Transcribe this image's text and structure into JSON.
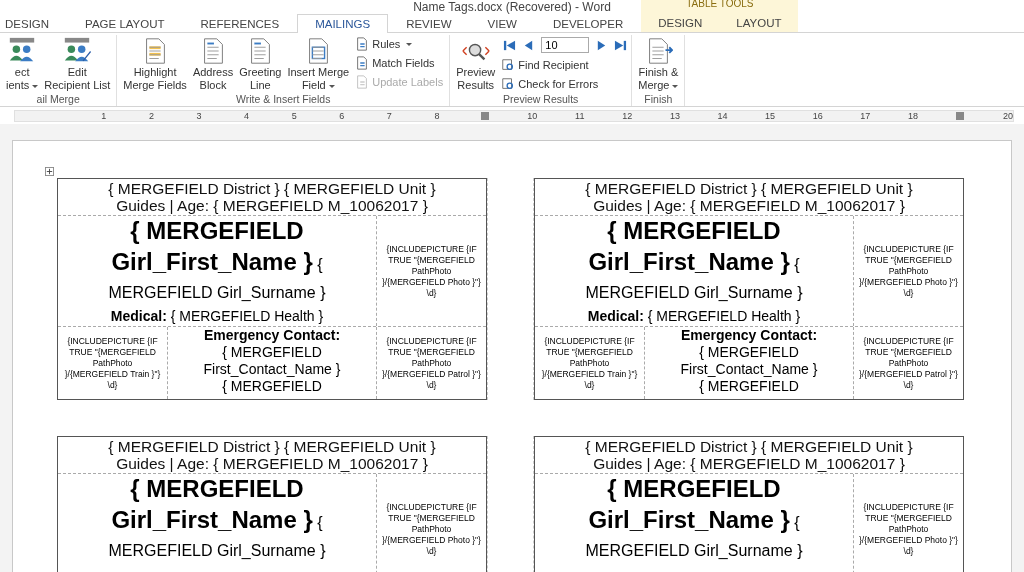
{
  "window": {
    "title": "Name Tags.docx (Recovered) - Word"
  },
  "tabs": [
    {
      "label": "DESIGN",
      "selected": false
    },
    {
      "label": "PAGE LAYOUT",
      "selected": false
    },
    {
      "label": "REFERENCES",
      "selected": false
    },
    {
      "label": "MAILINGS",
      "selected": true
    },
    {
      "label": "REVIEW",
      "selected": false
    },
    {
      "label": "VIEW",
      "selected": false
    },
    {
      "label": "DEVELOPER",
      "selected": false
    }
  ],
  "contextual": {
    "title": "TABLE TOOLS",
    "tabs": [
      {
        "label": "DESIGN",
        "selected": false
      },
      {
        "label": "LAYOUT",
        "selected": false
      }
    ]
  },
  "ribbon": [
    {
      "label": "ail Merge",
      "items": [
        {
          "kind": "large",
          "label": "ect\nients",
          "dropdown": true
        },
        {
          "kind": "large",
          "label": "Edit\nRecipient List",
          "dropdown": false
        }
      ]
    },
    {
      "label": "Write & Insert Fields",
      "items": [
        {
          "kind": "large",
          "label": "Highlight\nMerge Fields",
          "dropdown": false
        },
        {
          "kind": "large",
          "label": "Address\nBlock",
          "dropdown": false
        },
        {
          "kind": "large",
          "label": "Greeting\nLine",
          "dropdown": false
        },
        {
          "kind": "large",
          "label": "Insert Merge\nField",
          "dropdown": true
        },
        {
          "kind": "stack",
          "rows": [
            {
              "label": "Rules",
              "dropdown": true,
              "disabled": false
            },
            {
              "label": "Match Fields",
              "dropdown": false,
              "disabled": false
            },
            {
              "label": "Update Labels",
              "dropdown": false,
              "disabled": true
            }
          ]
        }
      ]
    },
    {
      "label": "Preview Results",
      "items": [
        {
          "kind": "large",
          "label": "Preview\nResults",
          "dropdown": false
        },
        {
          "kind": "nav",
          "record": "10",
          "rows": [
            {
              "label": "Find Recipient",
              "dropdown": false,
              "disabled": false
            },
            {
              "label": "Check for Errors",
              "dropdown": false,
              "disabled": false
            }
          ]
        }
      ]
    },
    {
      "label": "Finish",
      "items": [
        {
          "kind": "large",
          "label": "Finish &\nMerge",
          "dropdown": true
        }
      ]
    }
  ],
  "ruler": [
    {
      "kind": "number",
      "label": "1"
    },
    {
      "kind": "number",
      "label": "2"
    },
    {
      "kind": "number",
      "label": "3"
    },
    {
      "kind": "number",
      "label": "4"
    },
    {
      "kind": "number",
      "label": "5"
    },
    {
      "kind": "number",
      "label": "6"
    },
    {
      "kind": "number",
      "label": "7"
    },
    {
      "kind": "number",
      "label": "8"
    },
    {
      "kind": "marker"
    },
    {
      "kind": "number",
      "label": "10"
    },
    {
      "kind": "number",
      "label": "11"
    },
    {
      "kind": "number",
      "label": "12"
    },
    {
      "kind": "number",
      "label": "13"
    },
    {
      "kind": "number",
      "label": "14"
    },
    {
      "kind": "number",
      "label": "15"
    },
    {
      "kind": "number",
      "label": "16"
    },
    {
      "kind": "number",
      "label": "17"
    },
    {
      "kind": "number",
      "label": "18"
    },
    {
      "kind": "marker"
    },
    {
      "kind": "number",
      "label": "20"
    }
  ],
  "tags": [
    {
      "header": [
        "{ MERGEFIELD District } { MERGEFIELD Unit }",
        "Guides | Age: { MERGEFIELD M_10062017 }"
      ],
      "first_name": "{ MERGEFIELD Girl_First_Name }",
      "surname": "{ MERGEFIELD Girl_Surname }",
      "photo": "{INCLUDEPICTURE {IF TRUE \"{MERGEFIELD PathPhoto }/{MERGEFIELD Photo }\"} \\d}",
      "medical": "**Medical:** { MERGEFIELD Health }",
      "train": "{INCLUDEPICTURE {IF TRUE \"{MERGEFIELD PathPhoto }/{MERGEFIELD Train }\"} \\d}",
      "contact_heading": "Emergency Contact:",
      "contact": [
        "{ MERGEFIELD First_Contact_Name }",
        "{ MERGEFIELD"
      ],
      "patrol": "{INCLUDEPICTURE {IF TRUE \"{MERGEFIELD PathPhoto }/{MERGEFIELD Patrol }\"} \\d}"
    },
    {
      "header": [
        "{ MERGEFIELD District } { MERGEFIELD Unit }",
        "Guides | Age: { MERGEFIELD M_10062017 }"
      ],
      "first_name": "{ MERGEFIELD Girl_First_Name }",
      "surname": "{ MERGEFIELD Girl_Surname }",
      "photo": "{INCLUDEPICTURE {IF TRUE \"{MERGEFIELD PathPhoto }/{MERGEFIELD Photo }\"} \\d}",
      "medical": "**Medical:** { MERGEFIELD Health }",
      "train": "{INCLUDEPICTURE {IF TRUE \"{MERGEFIELD PathPhoto }/{MERGEFIELD Train }\"} \\d}",
      "contact_heading": "Emergency Contact:",
      "contact": [
        "{ MERGEFIELD First_Contact_Name }",
        "{ MERGEFIELD"
      ],
      "patrol": "{INCLUDEPICTURE {IF TRUE \"{MERGEFIELD PathPhoto }/{MERGEFIELD Patrol }\"} \\d}"
    },
    {
      "header": [
        "{ MERGEFIELD District } { MERGEFIELD Unit }",
        "Guides | Age: { MERGEFIELD M_10062017 }"
      ],
      "first_name": "{ MERGEFIELD Girl_First_Name }",
      "surname": "{ MERGEFIELD Girl_Surname }",
      "photo": "{INCLUDEPICTURE {IF TRUE \"{MERGEFIELD PathPhoto }/{MERGEFIELD Photo }\"} \\d}"
    },
    {
      "header": [
        "{ MERGEFIELD District } { MERGEFIELD Unit }",
        "Guides | Age: { MERGEFIELD M_10062017 }"
      ],
      "first_name": "{ MERGEFIELD Girl_First_Name }",
      "surname": "{ MERGEFIELD Girl_Surname }",
      "photo": "{INCLUDEPICTURE {IF TRUE \"{MERGEFIELD PathPhoto }/{MERGEFIELD Photo }\"} \\d}"
    }
  ]
}
